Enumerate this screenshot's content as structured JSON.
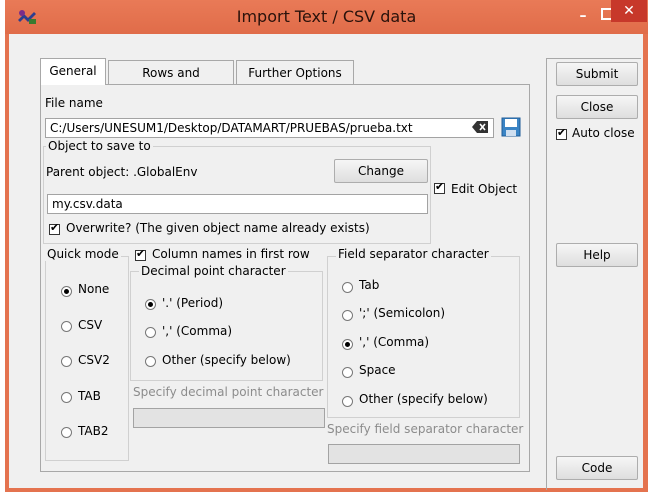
{
  "window": {
    "title": "Import Text / CSV data"
  },
  "tabs": [
    {
      "label": "General"
    },
    {
      "label": "Rows and Columns"
    },
    {
      "label": "Further Options"
    }
  ],
  "general": {
    "file_name_label": "File name",
    "file_path": "C:/Users/UNESUM1/Desktop/DATAMART/PRUEBAS/prueba.txt",
    "object_frame_title": "Object to save to",
    "parent_object_label": "Parent object: .GlobalEnv",
    "change_button": "Change",
    "object_name": "my.csv.data",
    "edit_object_label": "Edit Object",
    "overwrite_label": "Overwrite? (The given object name already exists)",
    "quick_mode": {
      "title": "Quick mode",
      "options": [
        "None",
        "CSV",
        "CSV2",
        "TAB",
        "TAB2"
      ],
      "selected": "None"
    },
    "column_names_label": "Column names in first row",
    "decimal": {
      "title": "Decimal point character",
      "options": [
        "'.' (Period)",
        "',' (Comma)",
        "Other (specify below)"
      ],
      "selected": "'.' (Period)",
      "specify_label": "Specify decimal point character"
    },
    "separator": {
      "title": "Field separator character",
      "options": [
        "Tab",
        "';' (Semicolon)",
        "',' (Comma)",
        "Space",
        "Other (specify below)"
      ],
      "selected": "',' (Comma)",
      "specify_label": "Specify field separator character"
    }
  },
  "side": {
    "submit": "Submit",
    "close": "Close",
    "auto_close": "Auto close",
    "help": "Help",
    "code": "Code"
  },
  "colors": {
    "titlebar": "#e4734f",
    "close_button": "#c7382a",
    "panel": "#f0f0f0"
  }
}
